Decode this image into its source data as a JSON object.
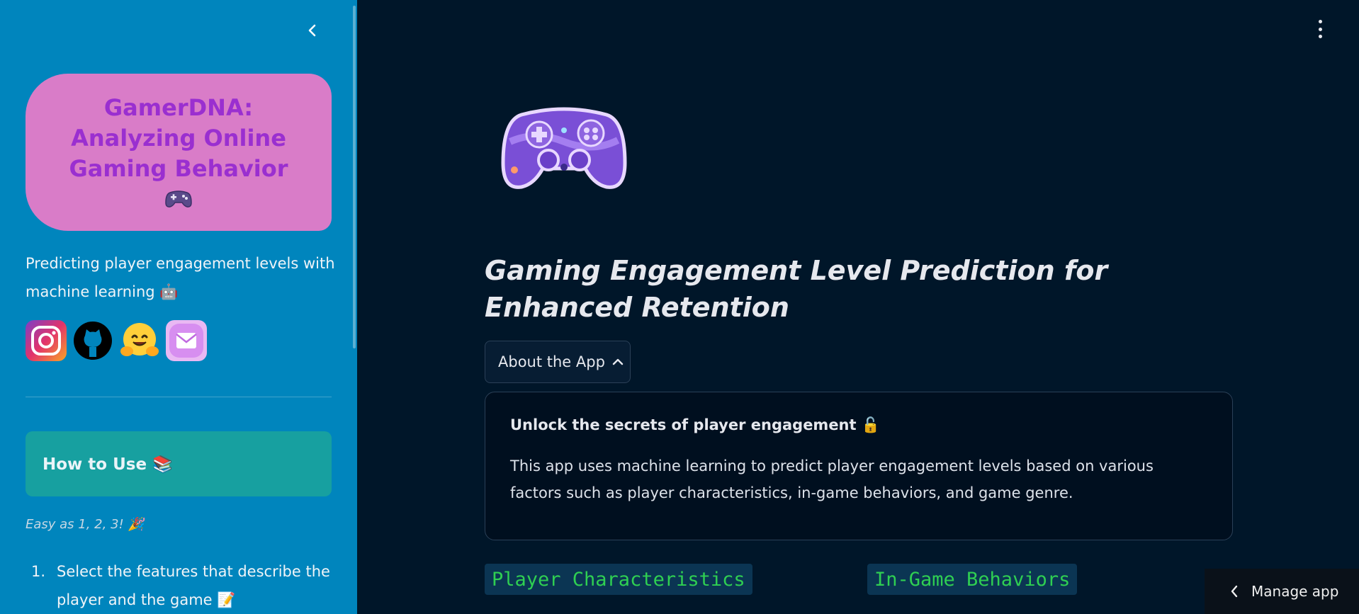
{
  "sidebar": {
    "title": "GamerDNA: Analyzing Online Gaming Behavior",
    "title_emoji": "🎮",
    "tagline": "Predicting player engagement levels with machine learning 🤖",
    "social_links": [
      {
        "icon": "instagram-icon"
      },
      {
        "icon": "github-icon"
      },
      {
        "icon": "huggingface-icon"
      },
      {
        "icon": "email-icon"
      }
    ],
    "how_to_label": "How to Use 📚",
    "easy_text": "Easy as 1, 2, 3! 🎉",
    "steps": [
      {
        "num": "1.",
        "text": "Select the features that describe the player and the game 📝"
      }
    ]
  },
  "main": {
    "heading": "Gaming Engagement Level Prediction for Enhanced Retention",
    "about_button_label": "About the App",
    "about": {
      "heading": "Unlock the secrets of player engagement 🔓",
      "body": "This app uses machine learning to predict player engagement levels based on various factors such as player characteristics, in-game behaviors, and game genre."
    },
    "sections": [
      "Player Characteristics",
      "In-Game Behaviors"
    ]
  },
  "manage_app_label": "Manage app",
  "colors": {
    "sidebar_bg": "#0085bd",
    "main_bg": "#001629",
    "title_card_bg": "#d97cc8",
    "title_text": "#9a2fd0",
    "how_to_bg": "#17a0a0",
    "code_green": "#2fcf52"
  }
}
